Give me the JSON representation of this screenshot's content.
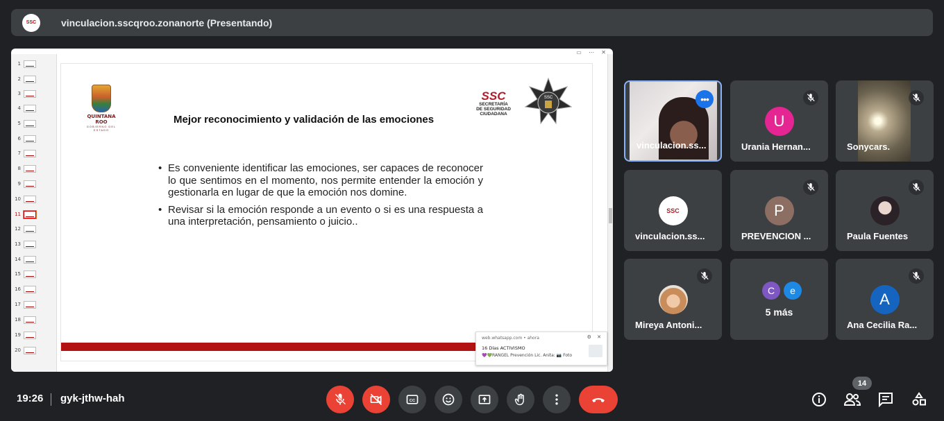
{
  "presenter": {
    "avatar_text": "SSC",
    "title": "vinculacion.sscqroo.zonanorte (Presentando)"
  },
  "slide_panel": {
    "thumbnails": [
      "1",
      "2",
      "3",
      "4",
      "5",
      "6",
      "7",
      "8",
      "9",
      "10",
      "11",
      "12",
      "13",
      "14",
      "15",
      "16",
      "17",
      "18",
      "19",
      "20"
    ],
    "active_index": 11,
    "toolbar_glyphs": "▭ ⋯ ✕"
  },
  "slide": {
    "title": "Mejor reconocimiento y validación de las emociones",
    "bullets": [
      "Es conveniente identificar las emociones, ser capaces de reconocer lo que sentimos en el momento, nos permite entender la emoción y gestionarla en lugar de que la emoción nos domine.",
      "Revisar si la emoción responde a un evento o si es una respuesta a una interpretación, pensamiento o juicio.."
    ],
    "left_logo": {
      "name": "QUINTANA ROO",
      "subtitle": "GOBIERNO DEL ESTADO"
    },
    "right_logo": {
      "acronym": "SSC",
      "line1": "SECRETARÍA",
      "line2": "DE SEGURIDAD",
      "line3": "CIUDADANA",
      "badge_text": "SSC"
    },
    "footer_color": "#b31212"
  },
  "notification": {
    "source": "web.whatsapp.com",
    "time": "• ahora",
    "title": "16 Días ACTIVISMO",
    "body": "💜💚RANGEL Prevención Lic. Anita: 📷 Foto",
    "controls": "⚙ ✕"
  },
  "participants": [
    {
      "name": "vinculacion.ss...",
      "type": "self-video",
      "more_label": "•••"
    },
    {
      "name": "Urania Hernan...",
      "type": "avatar",
      "initial": "U",
      "color": "#e52592",
      "muted": true
    },
    {
      "name": "Sonycars.",
      "type": "camera",
      "muted": true
    },
    {
      "name": "vinculacion.ss...",
      "type": "logo",
      "initial": "SSC",
      "muted": false
    },
    {
      "name": "PREVENCION ...",
      "type": "avatar",
      "initial": "P",
      "color": "#8d6e63",
      "muted": true
    },
    {
      "name": "Paula Fuentes",
      "type": "photo",
      "muted": true
    },
    {
      "name": "Mireya Antoni...",
      "type": "photo",
      "muted": true
    },
    {
      "name": "5 más",
      "type": "more",
      "initials": [
        "C",
        "e"
      ],
      "colors": [
        "#7e57c2",
        "#1e88e5"
      ]
    },
    {
      "name": "Ana Cecilia Ra...",
      "type": "avatar",
      "initial": "A",
      "color": "#1565c0",
      "muted": true
    }
  ],
  "bottom_bar": {
    "time": "19:26",
    "meeting_code": "gyk-jthw-hah",
    "people_count": "14",
    "controls": [
      "mic-off-icon",
      "cam-off-icon",
      "captions-icon",
      "emoji-icon",
      "present-icon",
      "raise-hand-icon",
      "more-vert-icon",
      "hangup-icon"
    ],
    "right_controls": [
      "info-icon",
      "people-icon",
      "chat-icon",
      "activities-icon"
    ]
  },
  "colors": {
    "background": "#202124",
    "tile": "#3c4043",
    "danger": "#ea4335",
    "accent": "#8ab4f8"
  }
}
